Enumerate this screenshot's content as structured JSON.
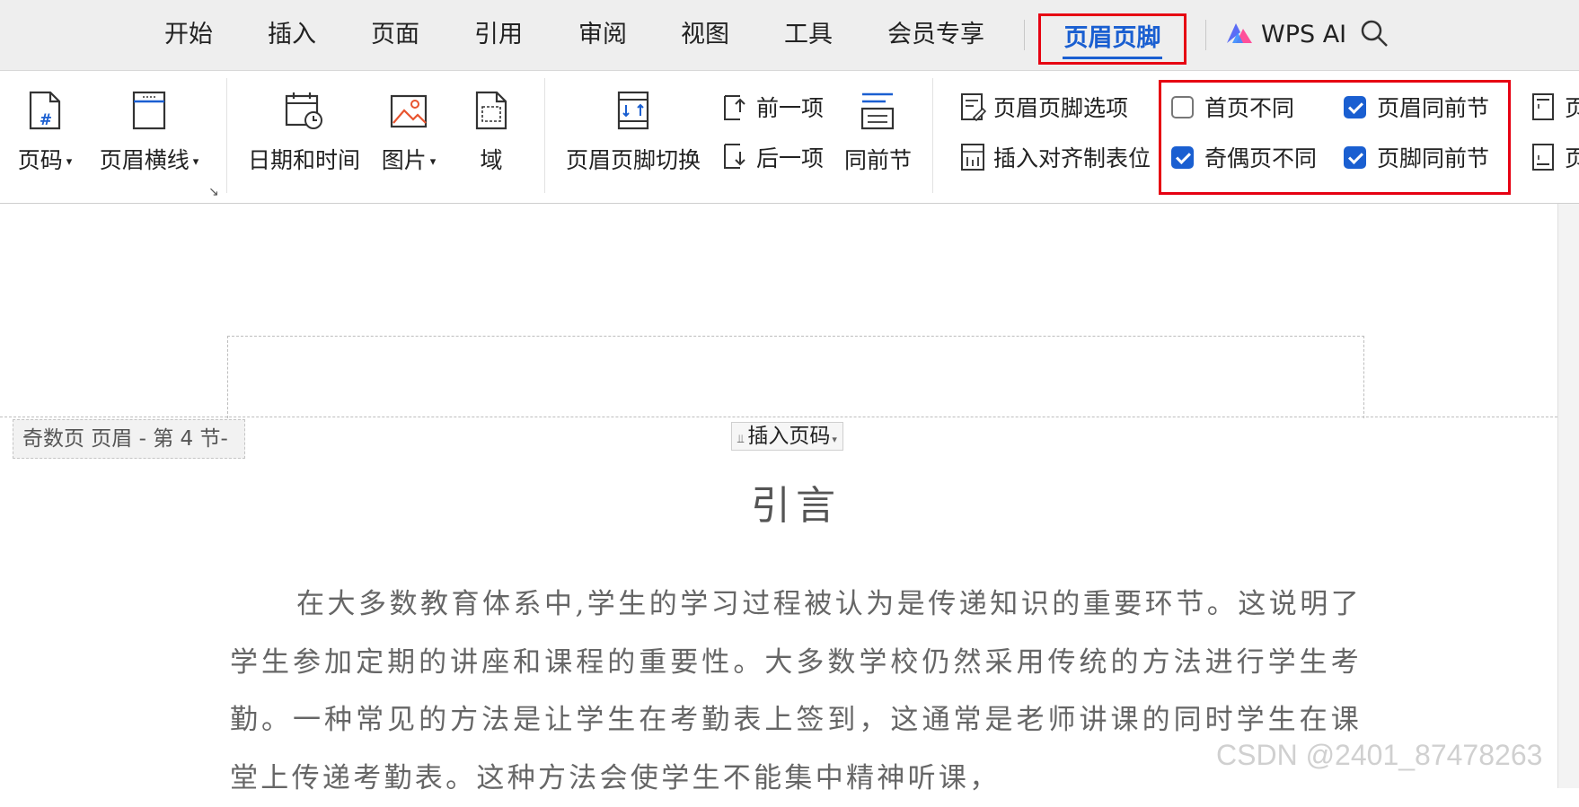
{
  "tabs": [
    "开始",
    "插入",
    "页面",
    "引用",
    "审阅",
    "视图",
    "工具",
    "会员专享"
  ],
  "active_tab": "页眉页脚",
  "wps_ai_label": "WPS AI",
  "ribbon": {
    "page_number": "页码",
    "header_line": "页眉横线",
    "date_time": "日期和时间",
    "picture": "图片",
    "field": "域",
    "switch": "页眉页脚切换",
    "prev": "前一项",
    "next": "后一项",
    "same_as_prev": "同前节",
    "options": "页眉页脚选项",
    "insert_align_tab": "插入对齐制表位",
    "checkboxes": {
      "first_page_diff": {
        "label": "首页不同",
        "checked": false
      },
      "odd_even_diff": {
        "label": "奇偶页不同",
        "checked": true
      },
      "header_same_prev": {
        "label": "页眉同前节",
        "checked": true
      },
      "footer_same_prev": {
        "label": "页脚同前节",
        "checked": true
      }
    },
    "clipped_label": "页"
  },
  "document": {
    "header_tag": "奇数页 页眉  - 第 4 节-",
    "insert_page_number": "插入页码",
    "title": "引言",
    "paragraph": "在大多数教育体系中,学生的学习过程被认为是传递知识的重要环节。这说明了学生参加定期的讲座和课程的重要性。大多数学校仍然采用传统的方法进行学生考勤。一种常见的方法是让学生在考勤表上签到，这通常是老师讲课的同时学生在课堂上传递考勤表。这种方法会使学生不能集中精神听课，"
  },
  "watermark": "CSDN @2401_87478263",
  "colors": {
    "accent": "#1a5fd1",
    "highlight_border": "#e60012"
  }
}
